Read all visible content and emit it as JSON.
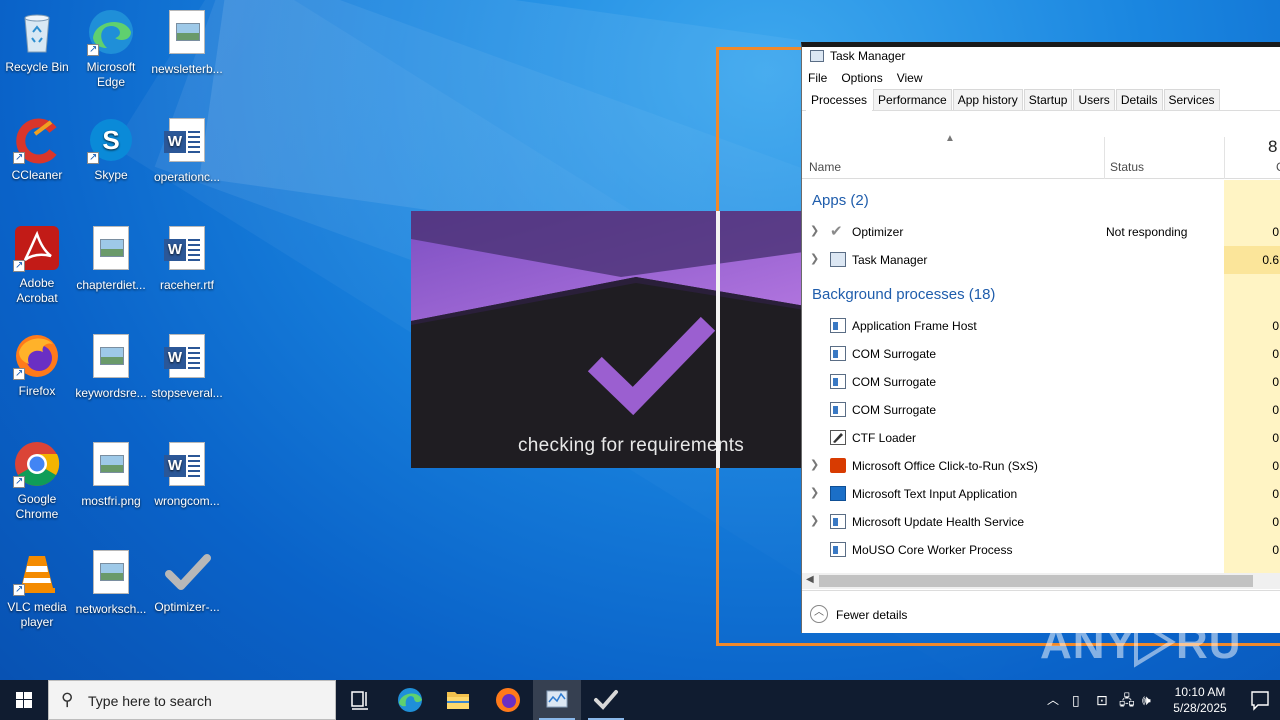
{
  "desktop": {
    "icons": [
      {
        "label": "Recycle Bin"
      },
      {
        "label": "Microsoft Edge"
      },
      {
        "label": "newsletterb..."
      },
      {
        "label": "CCleaner"
      },
      {
        "label": "Skype"
      },
      {
        "label": "operationc..."
      },
      {
        "label": "Adobe Acrobat"
      },
      {
        "label": "chapterdiet..."
      },
      {
        "label": "raceher.rtf"
      },
      {
        "label": "Firefox"
      },
      {
        "label": "keywordsre..."
      },
      {
        "label": "stopseveral..."
      },
      {
        "label": "Google Chrome"
      },
      {
        "label": "mostfri.png"
      },
      {
        "label": "wrongcom..."
      },
      {
        "label": "VLC media player"
      },
      {
        "label": "networksch..."
      },
      {
        "label": "Optimizer-..."
      }
    ]
  },
  "splash": {
    "message": "checking for requirements",
    "accent_color": "#9b5fd0"
  },
  "highlight_color": "#f0892b",
  "task_manager": {
    "title": "Task Manager",
    "menu": [
      "File",
      "Options",
      "View"
    ],
    "tabs": [
      "Processes",
      "Performance",
      "App history",
      "Startup",
      "Users",
      "Details",
      "Services"
    ],
    "active_tab": "Processes",
    "columns": {
      "name": "Name",
      "status": "Status",
      "cpu_header": "CP",
      "cpu_percent": "8"
    },
    "groups": {
      "apps": "Apps (2)",
      "background": "Background processes (18)"
    },
    "apps": [
      {
        "name": "Optimizer",
        "status": "Not responding",
        "cpu": "0",
        "icon": "checkmark-icon",
        "expandable": true
      },
      {
        "name": "Task Manager",
        "status": "",
        "cpu": "0.6",
        "icon": "task-manager-icon",
        "expandable": true
      }
    ],
    "background": [
      {
        "name": "Application Frame Host",
        "cpu": "0",
        "icon": "window-icon",
        "expandable": false
      },
      {
        "name": "COM Surrogate",
        "cpu": "0",
        "icon": "window-icon",
        "expandable": false
      },
      {
        "name": "COM Surrogate",
        "cpu": "0",
        "icon": "window-icon",
        "expandable": false
      },
      {
        "name": "COM Surrogate",
        "cpu": "0",
        "icon": "window-icon",
        "expandable": false
      },
      {
        "name": "CTF Loader",
        "cpu": "0",
        "icon": "pen-icon",
        "expandable": false
      },
      {
        "name": "Microsoft Office Click-to-Run (SxS)",
        "cpu": "0",
        "icon": "office-icon",
        "expandable": true
      },
      {
        "name": "Microsoft Text Input Application",
        "cpu": "0",
        "icon": "keyboard-icon",
        "expandable": true
      },
      {
        "name": "Microsoft Update Health Service",
        "cpu": "0",
        "icon": "window-icon",
        "expandable": true
      },
      {
        "name": "MoUSO Core Worker Process",
        "cpu": "0",
        "icon": "window-icon",
        "expandable": false
      }
    ],
    "footer": "Fewer details"
  },
  "watermark": "ANY RUN",
  "taskbar": {
    "search_placeholder": "Type here to search",
    "time": "10:10 AM",
    "date": "5/28/2025"
  }
}
